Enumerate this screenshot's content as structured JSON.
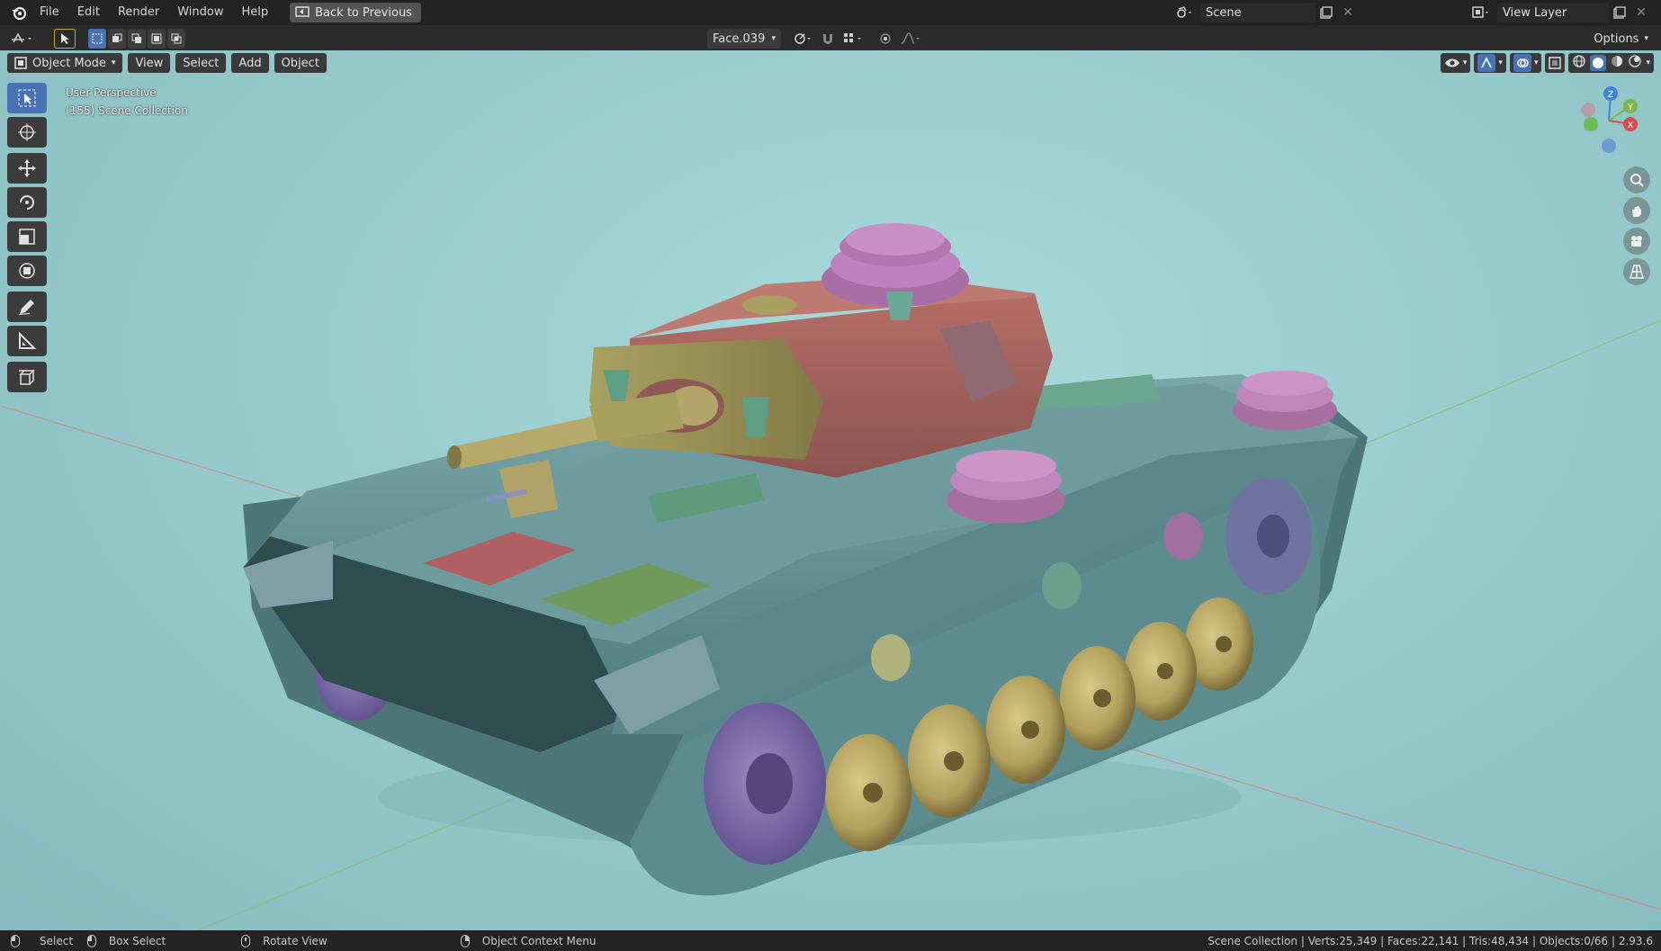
{
  "menu": [
    "File",
    "Edit",
    "Render",
    "Window",
    "Help"
  ],
  "back_button": "Back to Previous",
  "scene": {
    "label": "Scene"
  },
  "view_layer": {
    "label": "View Layer"
  },
  "toolbar": {
    "face_field": "Face.039",
    "options_label": "Options"
  },
  "header": {
    "mode": "Object Mode",
    "view": "View",
    "select": "Select",
    "add": "Add",
    "object": "Object"
  },
  "viewport": {
    "perspective": "User Perspective",
    "collection": "(155) Scene Collection"
  },
  "gizmo": {
    "z": "Z",
    "y": "Y",
    "x": "X"
  },
  "status": {
    "select": "Select",
    "box_select": "Box Select",
    "rotate_view": "Rotate View",
    "context_menu": "Object Context Menu",
    "stats": "Scene Collection | Verts:25,349 | Faces:22,141 | Tris:48,434 | Objects:0/66 | 2.93.6"
  },
  "colors": {
    "accent": "#4772b3",
    "background": "#93c7c9",
    "turret": "#a0655f",
    "hull": "#5f8f90",
    "wheels": "#b9a865",
    "sprocket": "#7a6aa7"
  }
}
